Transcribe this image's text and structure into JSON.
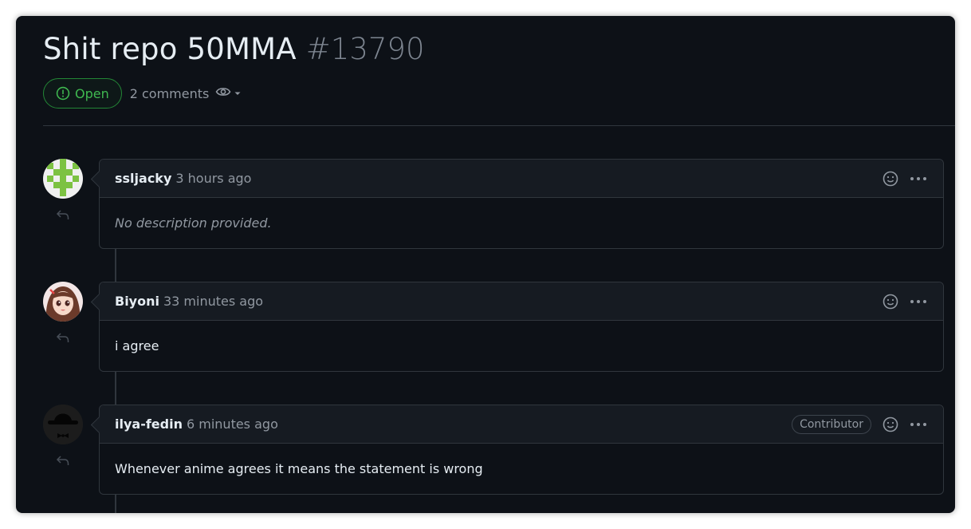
{
  "issue": {
    "title": "Shit repo 50MMA",
    "number": "#13790",
    "state": "Open",
    "comment_count": "2 comments"
  },
  "icons": {
    "state": "issue-opened-icon",
    "watch": "eye-icon",
    "watch_menu": "triangle-down-icon",
    "reply": "reply-icon",
    "reaction": "smiley-icon",
    "more": "kebab-horizontal-icon"
  },
  "comments": [
    {
      "author": "ssljacky",
      "time": "3 hours ago",
      "body": "No description provided.",
      "avatar": "identicon-green",
      "role": ""
    },
    {
      "author": "Biyoni",
      "time": "33 minutes ago",
      "body": "i agree",
      "avatar": "anime-girl-avatar",
      "role": ""
    },
    {
      "author": "ilya-fedin",
      "time": "6 minutes ago",
      "body": "Whenever anime agrees it means the statement is wrong",
      "avatar": "bowler-hat-avatar",
      "role": "Contributor"
    }
  ],
  "colors": {
    "background": "#0d1117",
    "open_green": "#3fb950",
    "border": "#30363d",
    "muted": "#9198a1",
    "text": "#e6edf3"
  }
}
